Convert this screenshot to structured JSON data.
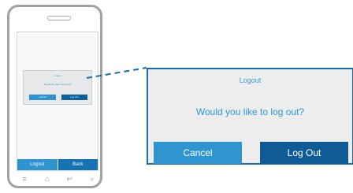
{
  "phone": {
    "mini_dialog": {
      "title": "Logout",
      "message": "Would you like to log out?",
      "cancel_label": "Cancel",
      "logout_label": "Log Out"
    },
    "tabbar": {
      "logout_label": "Logout",
      "back_label": "Back"
    },
    "navbar": {
      "icons": [
        "menu-icon",
        "home-icon",
        "back-icon",
        "search-icon"
      ]
    }
  },
  "dialog": {
    "title": "Logout",
    "message": "Would you like to log out?",
    "cancel_label": "Cancel",
    "logout_label": "Log Out"
  },
  "colors": {
    "accent_light": "#2f95d1",
    "accent_dark": "#0e5b95",
    "frame": "#9fa1a3"
  }
}
